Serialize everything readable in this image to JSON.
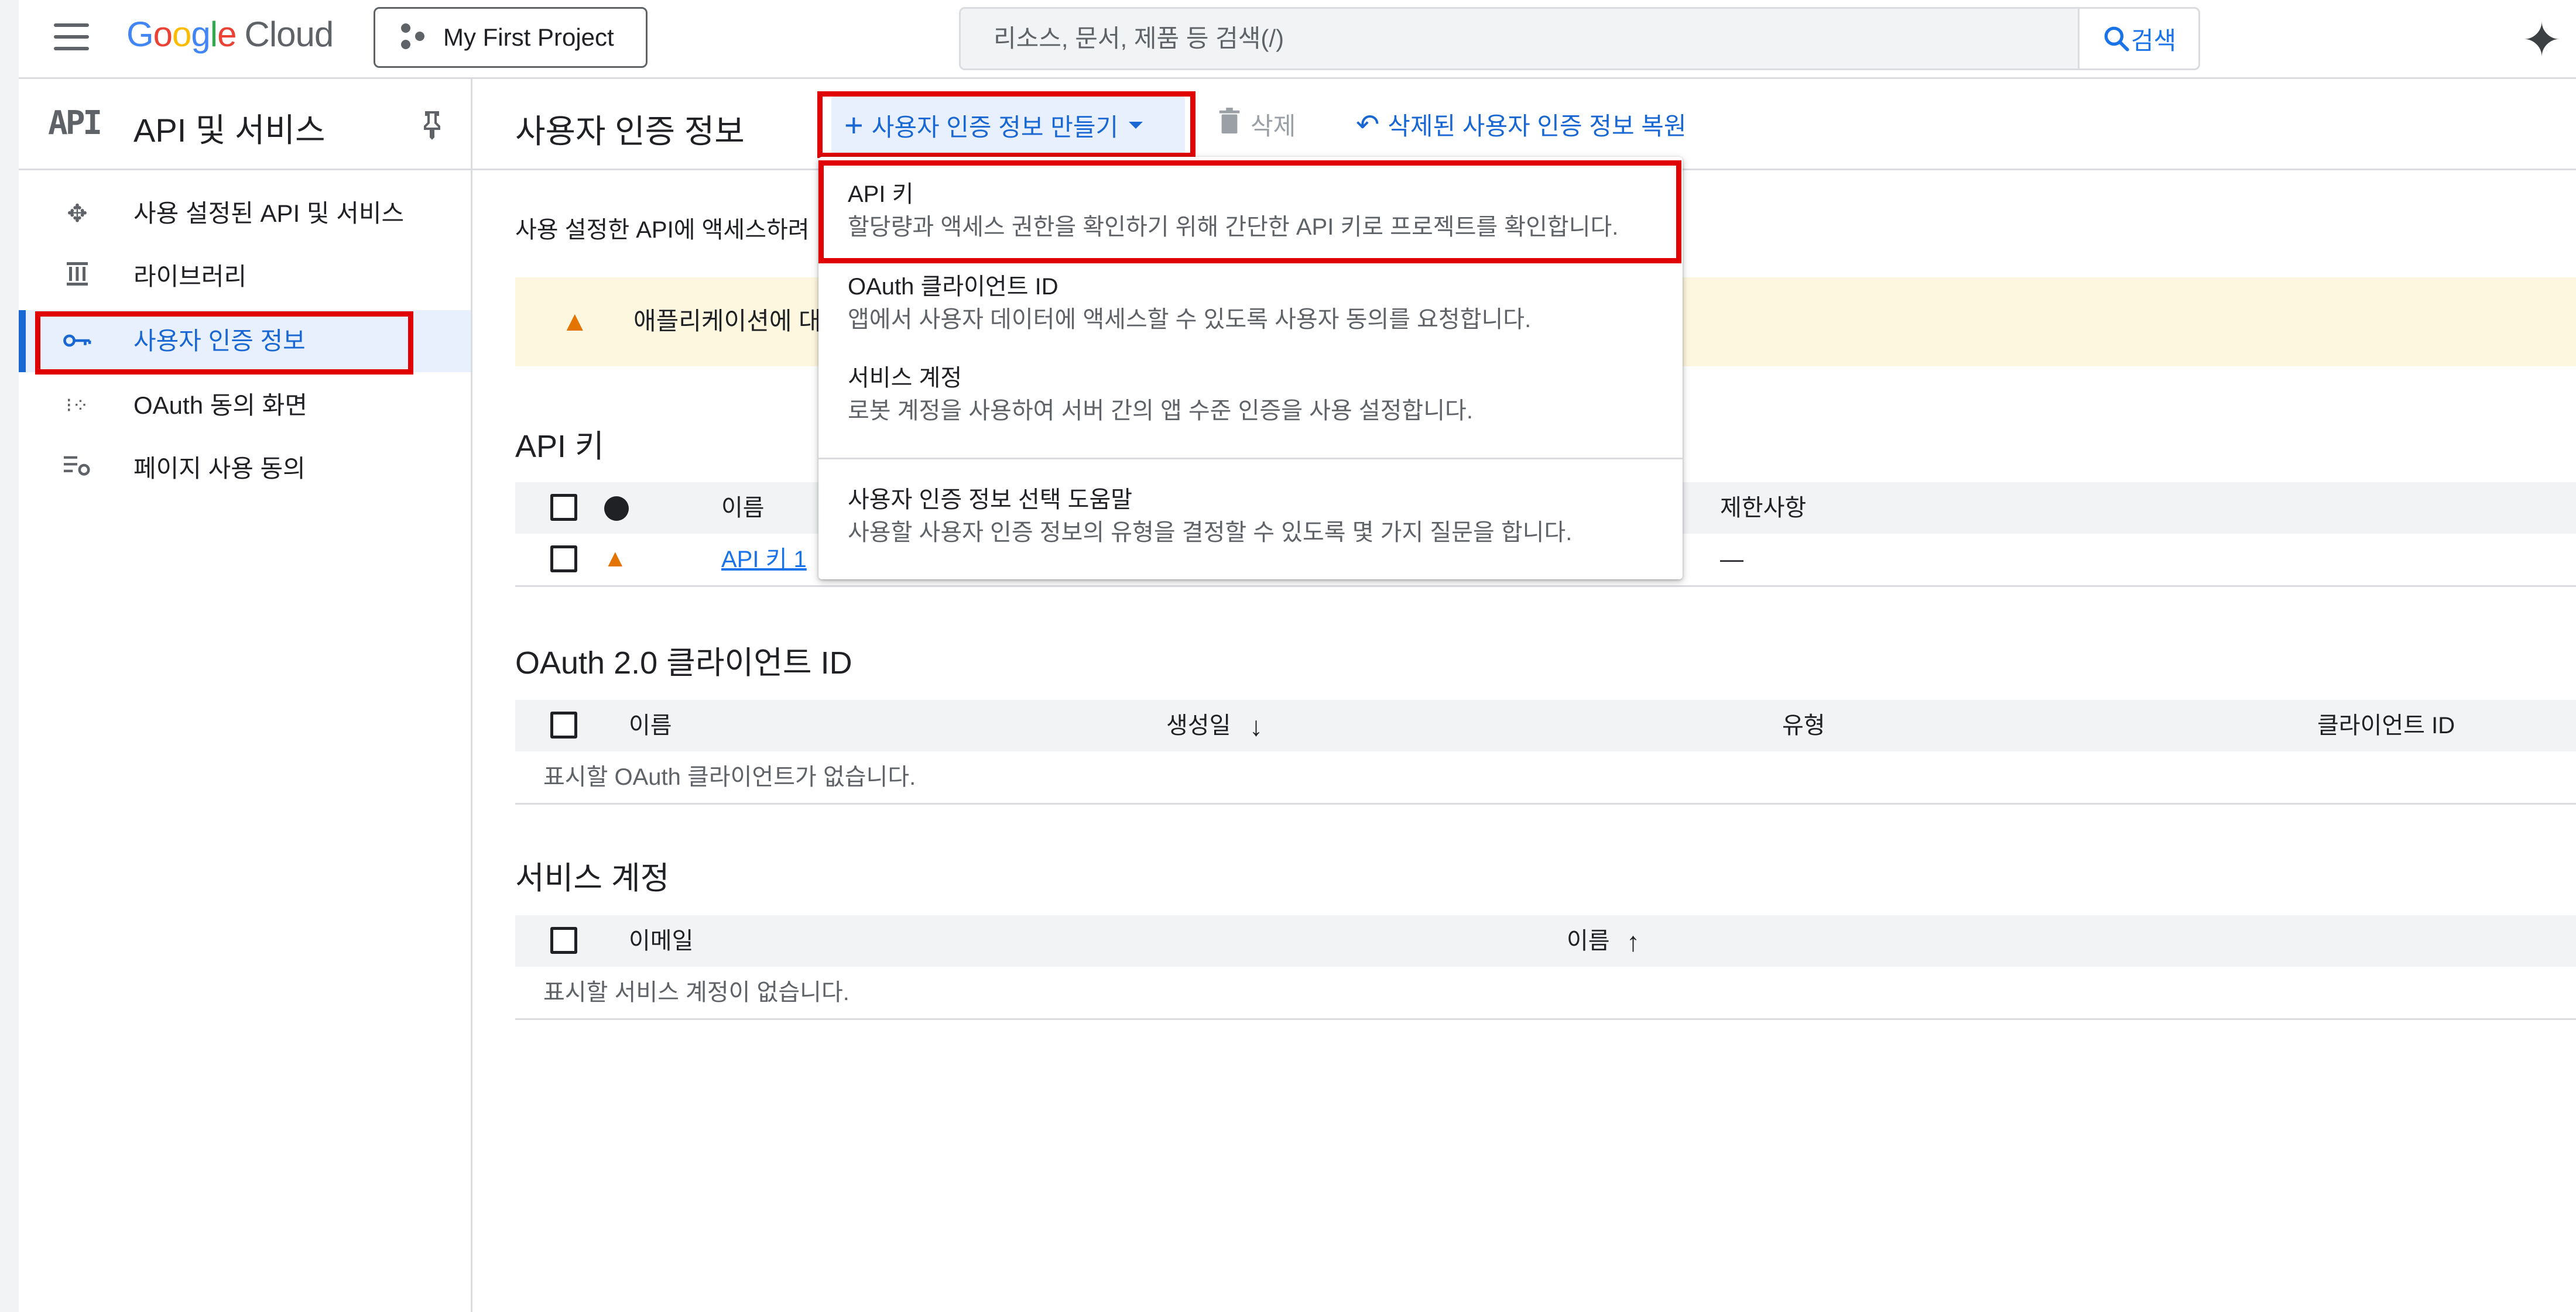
{
  "topbar": {
    "logo_google": [
      "G",
      "o",
      "o",
      "g",
      "l",
      "e"
    ],
    "logo_cloud": "Cloud",
    "project": "My First Project",
    "search_placeholder": "리소스, 문서, 제품 등 검색(/)",
    "search_button": "검색"
  },
  "sidebar": {
    "api_badge": "API",
    "title": "API 및 서비스",
    "items": [
      {
        "label": "사용 설정된 API 및 서비스",
        "icon": "api-hub-icon"
      },
      {
        "label": "라이브러리",
        "icon": "library-icon"
      },
      {
        "label": "사용자 인증 정보",
        "icon": "key-icon",
        "active": true
      },
      {
        "label": "OAuth 동의 화면",
        "icon": "oauth-consent-icon"
      },
      {
        "label": "페이지 사용 동의",
        "icon": "page-usage-icon"
      }
    ]
  },
  "header": {
    "title": "사용자 인증 정보",
    "create_label": "사용자 인증 정보 만들기",
    "delete_label": "삭제",
    "restore_label": "삭제된 사용자 인증 정보 복원"
  },
  "content": {
    "intro": "사용 설정한 API에 액세스하려",
    "warning": "애플리케이션에 대",
    "api_keys": {
      "title": "API 키",
      "col_name": "이름",
      "col_restrictions": "제한사항",
      "rows": [
        {
          "name": "API 키 1",
          "restrictions": "—"
        }
      ]
    },
    "oauth": {
      "title": "OAuth 2.0 클라이언트 ID",
      "col_name": "이름",
      "col_created": "생성일",
      "col_type": "유형",
      "col_client_id": "클라이언트 ID",
      "empty": "표시할 OAuth 클라이언트가 없습니다."
    },
    "service_accounts": {
      "title": "서비스 계정",
      "col_email": "이메일",
      "col_name": "이름",
      "empty": "표시할 서비스 계정이 없습니다."
    }
  },
  "menu": {
    "items": [
      {
        "title": "API 키",
        "desc": "할당량과 액세스 권한을 확인하기 위해 간단한 API 키로 프로젝트를 확인합니다."
      },
      {
        "title": "OAuth 클라이언트 ID",
        "desc": "앱에서 사용자 데이터에 액세스할 수 있도록 사용자 동의를 요청합니다."
      },
      {
        "title": "서비스 계정",
        "desc": "로봇 계정을 사용하여 서버 간의 앱 수준 인증을 사용 설정합니다."
      },
      {
        "title": "사용자 인증 정보 선택 도움말",
        "desc": "사용할 사용자 인증 정보의 유형을 결정할 수 있도록 몇 가지 질문을 합니다."
      }
    ]
  },
  "colors": {
    "accent": "#1967d2",
    "highlight": "#e00000",
    "warning": "#e37400"
  }
}
